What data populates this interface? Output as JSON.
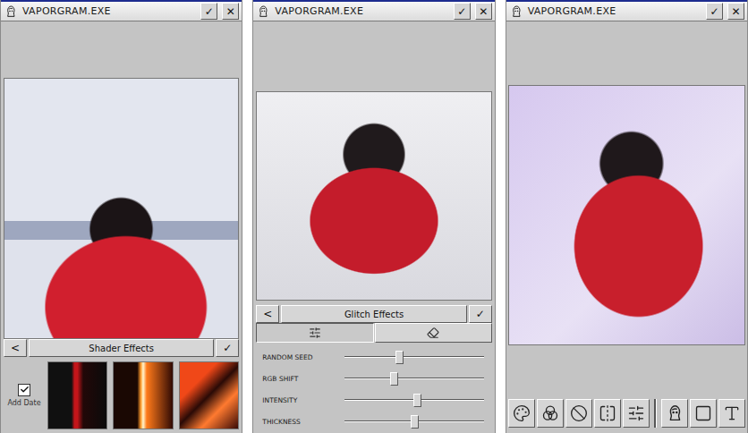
{
  "windows": [
    {
      "kind": "shader",
      "title": "VAPORGRAM.EXE",
      "title_buttons": [
        "✓",
        "✕"
      ],
      "panel": {
        "back": "<",
        "title": "Shader Effects",
        "apply": "✓"
      },
      "add_date": {
        "label": "Add Date",
        "checked": true
      },
      "thumbnails": [
        {
          "selected": false
        },
        {
          "selected": false
        },
        {
          "selected": false
        }
      ]
    },
    {
      "kind": "glitch",
      "title": "VAPORGRAM.EXE",
      "title_buttons": [
        "✓",
        "✕"
      ],
      "panel": {
        "back": "<",
        "title": "Glitch Effects",
        "apply": "✓"
      },
      "tabs": [
        {
          "kind": "sliders",
          "selected": true
        },
        {
          "kind": "eraser",
          "selected": false
        }
      ],
      "sliders": [
        {
          "label": "RANDOM SEED",
          "level": 0.39
        },
        {
          "label": "RGB SHIFT",
          "level": 0.35
        },
        {
          "label": "INTENSITY",
          "level": 0.52
        },
        {
          "label": "THICKNESS",
          "level": 0.5
        }
      ]
    },
    {
      "kind": "editor",
      "title": "VAPORGRAM.EXE",
      "title_buttons": [
        "✓",
        "✕"
      ],
      "tool_groups": [
        {
          "tools": [
            {
              "kind": "palette",
              "selected": false
            },
            {
              "kind": "blend",
              "selected": false
            },
            {
              "kind": "erase",
              "selected": false
            },
            {
              "kind": "flip",
              "selected": false
            },
            {
              "kind": "adjust",
              "selected": false
            }
          ]
        },
        {
          "tools": [
            {
              "kind": "sticker",
              "selected": false
            },
            {
              "kind": "frame",
              "selected": false
            },
            {
              "kind": "text",
              "selected": false
            }
          ]
        }
      ]
    }
  ]
}
